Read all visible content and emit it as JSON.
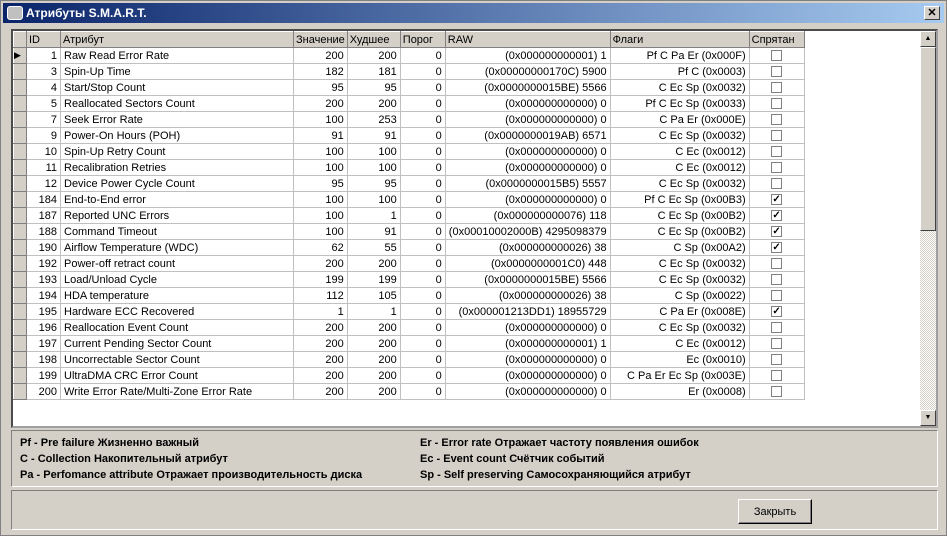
{
  "window": {
    "title": "Атрибуты S.M.A.R.T.",
    "close": "✕"
  },
  "columns": [
    "ID",
    "Атрибут",
    "Значение",
    "Худшее",
    "Порог",
    "RAW",
    "Флаги",
    "Спрятан"
  ],
  "rows": [
    [
      "1",
      "Raw Read Error Rate",
      "200",
      "200",
      "0",
      "1 (0x000000000001)",
      "Pf C Pa Er  (0x000F)",
      false
    ],
    [
      "3",
      "Spin-Up Time",
      "182",
      "181",
      "0",
      "5900 (0x00000000170C)",
      "Pf C  (0x0003)",
      false
    ],
    [
      "4",
      "Start/Stop Count",
      "95",
      "95",
      "0",
      "5566 (0x0000000015BE)",
      "C Ec Sp  (0x0032)",
      false
    ],
    [
      "5",
      "Reallocated Sectors Count",
      "200",
      "200",
      "0",
      "0 (0x000000000000)",
      "Pf C Ec Sp  (0x0033)",
      false
    ],
    [
      "7",
      "Seek Error Rate",
      "100",
      "253",
      "0",
      "0 (0x000000000000)",
      "C Pa Er  (0x000E)",
      false
    ],
    [
      "9",
      "Power-On Hours (POH)",
      "91",
      "91",
      "0",
      "6571 (0x0000000019AB)",
      "C Ec Sp  (0x0032)",
      false
    ],
    [
      "10",
      "Spin-Up Retry Count",
      "100",
      "100",
      "0",
      "0 (0x000000000000)",
      "C Ec  (0x0012)",
      false
    ],
    [
      "11",
      "Recalibration Retries",
      "100",
      "100",
      "0",
      "0 (0x000000000000)",
      "C Ec  (0x0012)",
      false
    ],
    [
      "12",
      "Device Power Cycle Count",
      "95",
      "95",
      "0",
      "5557 (0x0000000015B5)",
      "C Ec Sp  (0x0032)",
      false
    ],
    [
      "184",
      "End-to-End error",
      "100",
      "100",
      "0",
      "0 (0x000000000000)",
      "Pf C Ec Sp  (0x00B3)",
      true
    ],
    [
      "187",
      "Reported UNC Errors",
      "100",
      "1",
      "0",
      "118 (0x000000000076)",
      "C Ec Sp  (0x00B2)",
      true
    ],
    [
      "188",
      "Command Timeout",
      "100",
      "91",
      "0",
      "4295098379 (0x00010002000B)",
      "C Ec Sp  (0x00B2)",
      true
    ],
    [
      "190",
      "Airflow Temperature (WDC)",
      "62",
      "55",
      "0",
      "38 (0x000000000026)",
      "C Sp  (0x00A2)",
      true
    ],
    [
      "192",
      "Power-off retract count",
      "200",
      "200",
      "0",
      "448 (0x0000000001C0)",
      "C Ec Sp  (0x0032)",
      false
    ],
    [
      "193",
      "Load/Unload Cycle",
      "199",
      "199",
      "0",
      "5566 (0x0000000015BE)",
      "C Ec Sp  (0x0032)",
      false
    ],
    [
      "194",
      "HDA temperature",
      "112",
      "105",
      "0",
      "38 (0x000000000026)",
      "C Sp  (0x0022)",
      false
    ],
    [
      "195",
      "Hardware ECC Recovered",
      "1",
      "1",
      "0",
      "18955729 (0x000001213DD1)",
      "C Pa Er  (0x008E)",
      true
    ],
    [
      "196",
      "Reallocation Event Count",
      "200",
      "200",
      "0",
      "0 (0x000000000000)",
      "C Ec Sp  (0x0032)",
      false
    ],
    [
      "197",
      "Current Pending Sector Count",
      "200",
      "200",
      "0",
      "1 (0x000000000001)",
      "C Ec  (0x0012)",
      false
    ],
    [
      "198",
      "Uncorrectable Sector Count",
      "200",
      "200",
      "0",
      "0 (0x000000000000)",
      "Ec  (0x0010)",
      false
    ],
    [
      "199",
      "UltraDMA CRC Error Count",
      "200",
      "200",
      "0",
      "0 (0x000000000000)",
      "C Pa Er Ec Sp  (0x003E)",
      false
    ],
    [
      "200",
      "Write Error Rate/Multi-Zone Error Rate",
      "200",
      "200",
      "0",
      "0 (0x000000000000)",
      "Er  (0x0008)",
      false
    ]
  ],
  "legend": {
    "pf": "Pf - Pre failure Жизненно важный",
    "c": "C - Collection Накопительный атрибут",
    "pa": "Pa - Perfomance attribute Отражает производительность диска",
    "er": "Er - Error rate Отражает частоту появления ошибок",
    "ec": "Ec - Event count Счётчик событий",
    "sp": "Sp - Self preserving Самосохраняющийся атрибут"
  },
  "buttons": {
    "close": "Закрыть"
  }
}
